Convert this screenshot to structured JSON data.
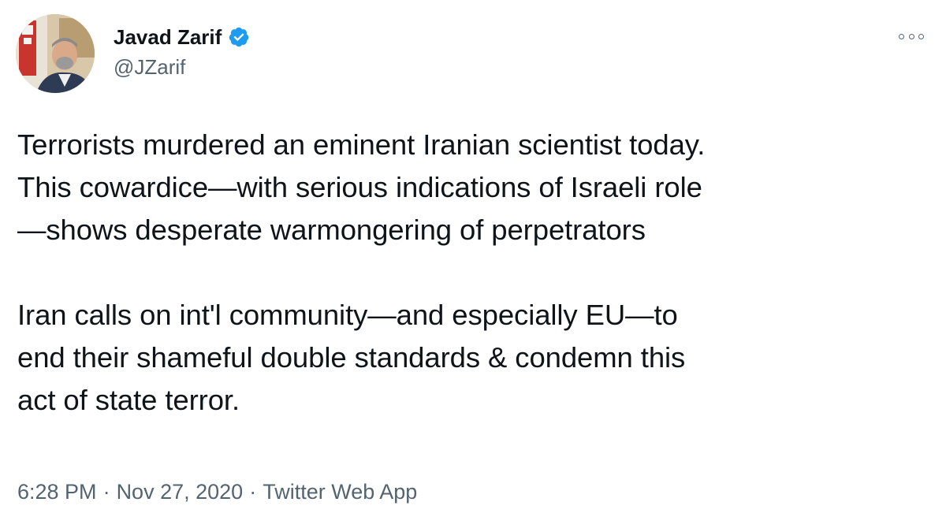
{
  "author": {
    "display_name": "Javad Zarif",
    "handle": "@JZarif",
    "verified_icon": "verified-badge-icon",
    "avatar_icon": "profile-photo"
  },
  "more_icon": "more-options-icon",
  "tweet": {
    "paragraph_1": "Terrorists murdered an eminent Iranian scientist today.\nThis cowardice—with serious indications of Israeli role\n—shows desperate warmongering of perpetrators",
    "paragraph_2": "Iran calls on int'l community—and especially EU—to\nend their shameful double standards & condemn this\nact of state terror."
  },
  "meta": {
    "time": "6:28 PM",
    "date": "Nov 27, 2020",
    "separator": "·",
    "source": "Twitter Web App"
  },
  "colors": {
    "text": "#0f1419",
    "secondary": "#536471",
    "verified": "#1d9bf0"
  }
}
